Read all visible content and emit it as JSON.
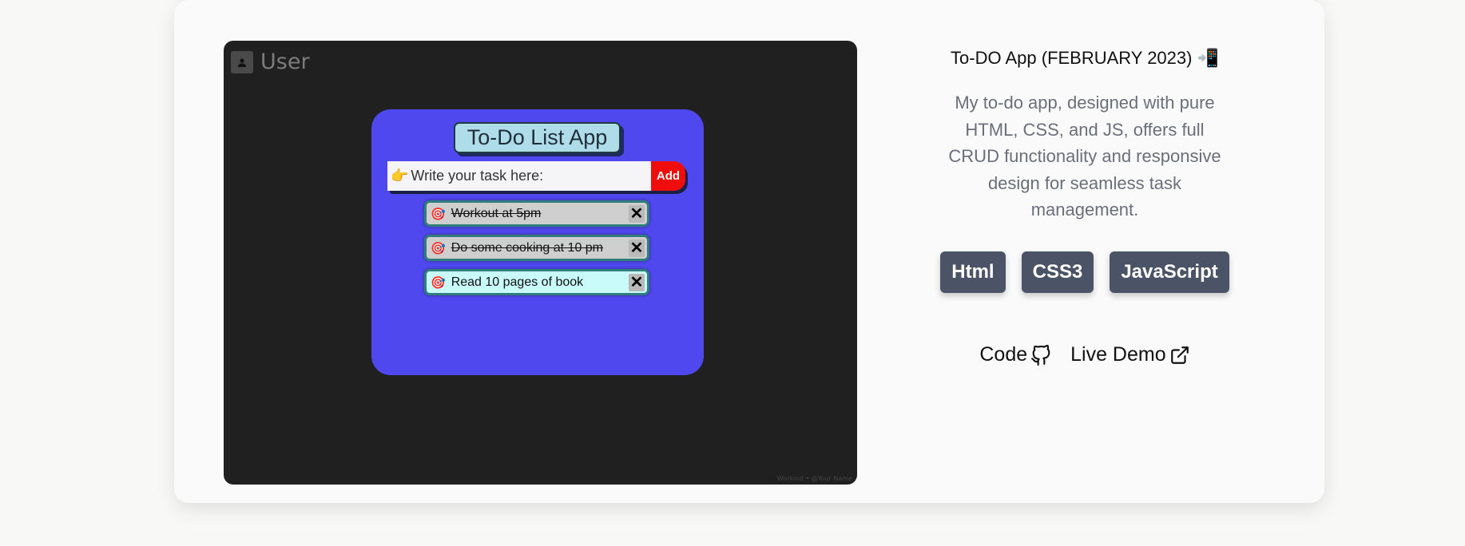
{
  "screenshot": {
    "user_label": "User",
    "footer_text": "Workout • @Your Name",
    "app": {
      "title": "To-Do List App",
      "input_emoji": "👉",
      "input_placeholder": "Write your task here:",
      "add_label": "Add",
      "tasks": [
        {
          "text": "Workout at 5pm",
          "done": true
        },
        {
          "text": "Do some cooking at 10 pm",
          "done": true
        },
        {
          "text": "Read 10 pages of book",
          "done": false
        }
      ],
      "task_icon": "🎯",
      "delete_icon": "✕"
    }
  },
  "project": {
    "title": "To-DO App (FEBRUARY 2023) 📲",
    "description": "My to-do app, designed with pure HTML, CSS, and JS, offers full CRUD functionality and responsive design for seamless task management.",
    "tags": [
      "Html",
      "CSS3",
      "JavaScript"
    ],
    "links": {
      "code": "Code",
      "demo": "Live Demo"
    }
  },
  "colors": {
    "panel": "#4f48ee",
    "tag_bg": "#4b5366",
    "add_button": "#f20d0d"
  }
}
